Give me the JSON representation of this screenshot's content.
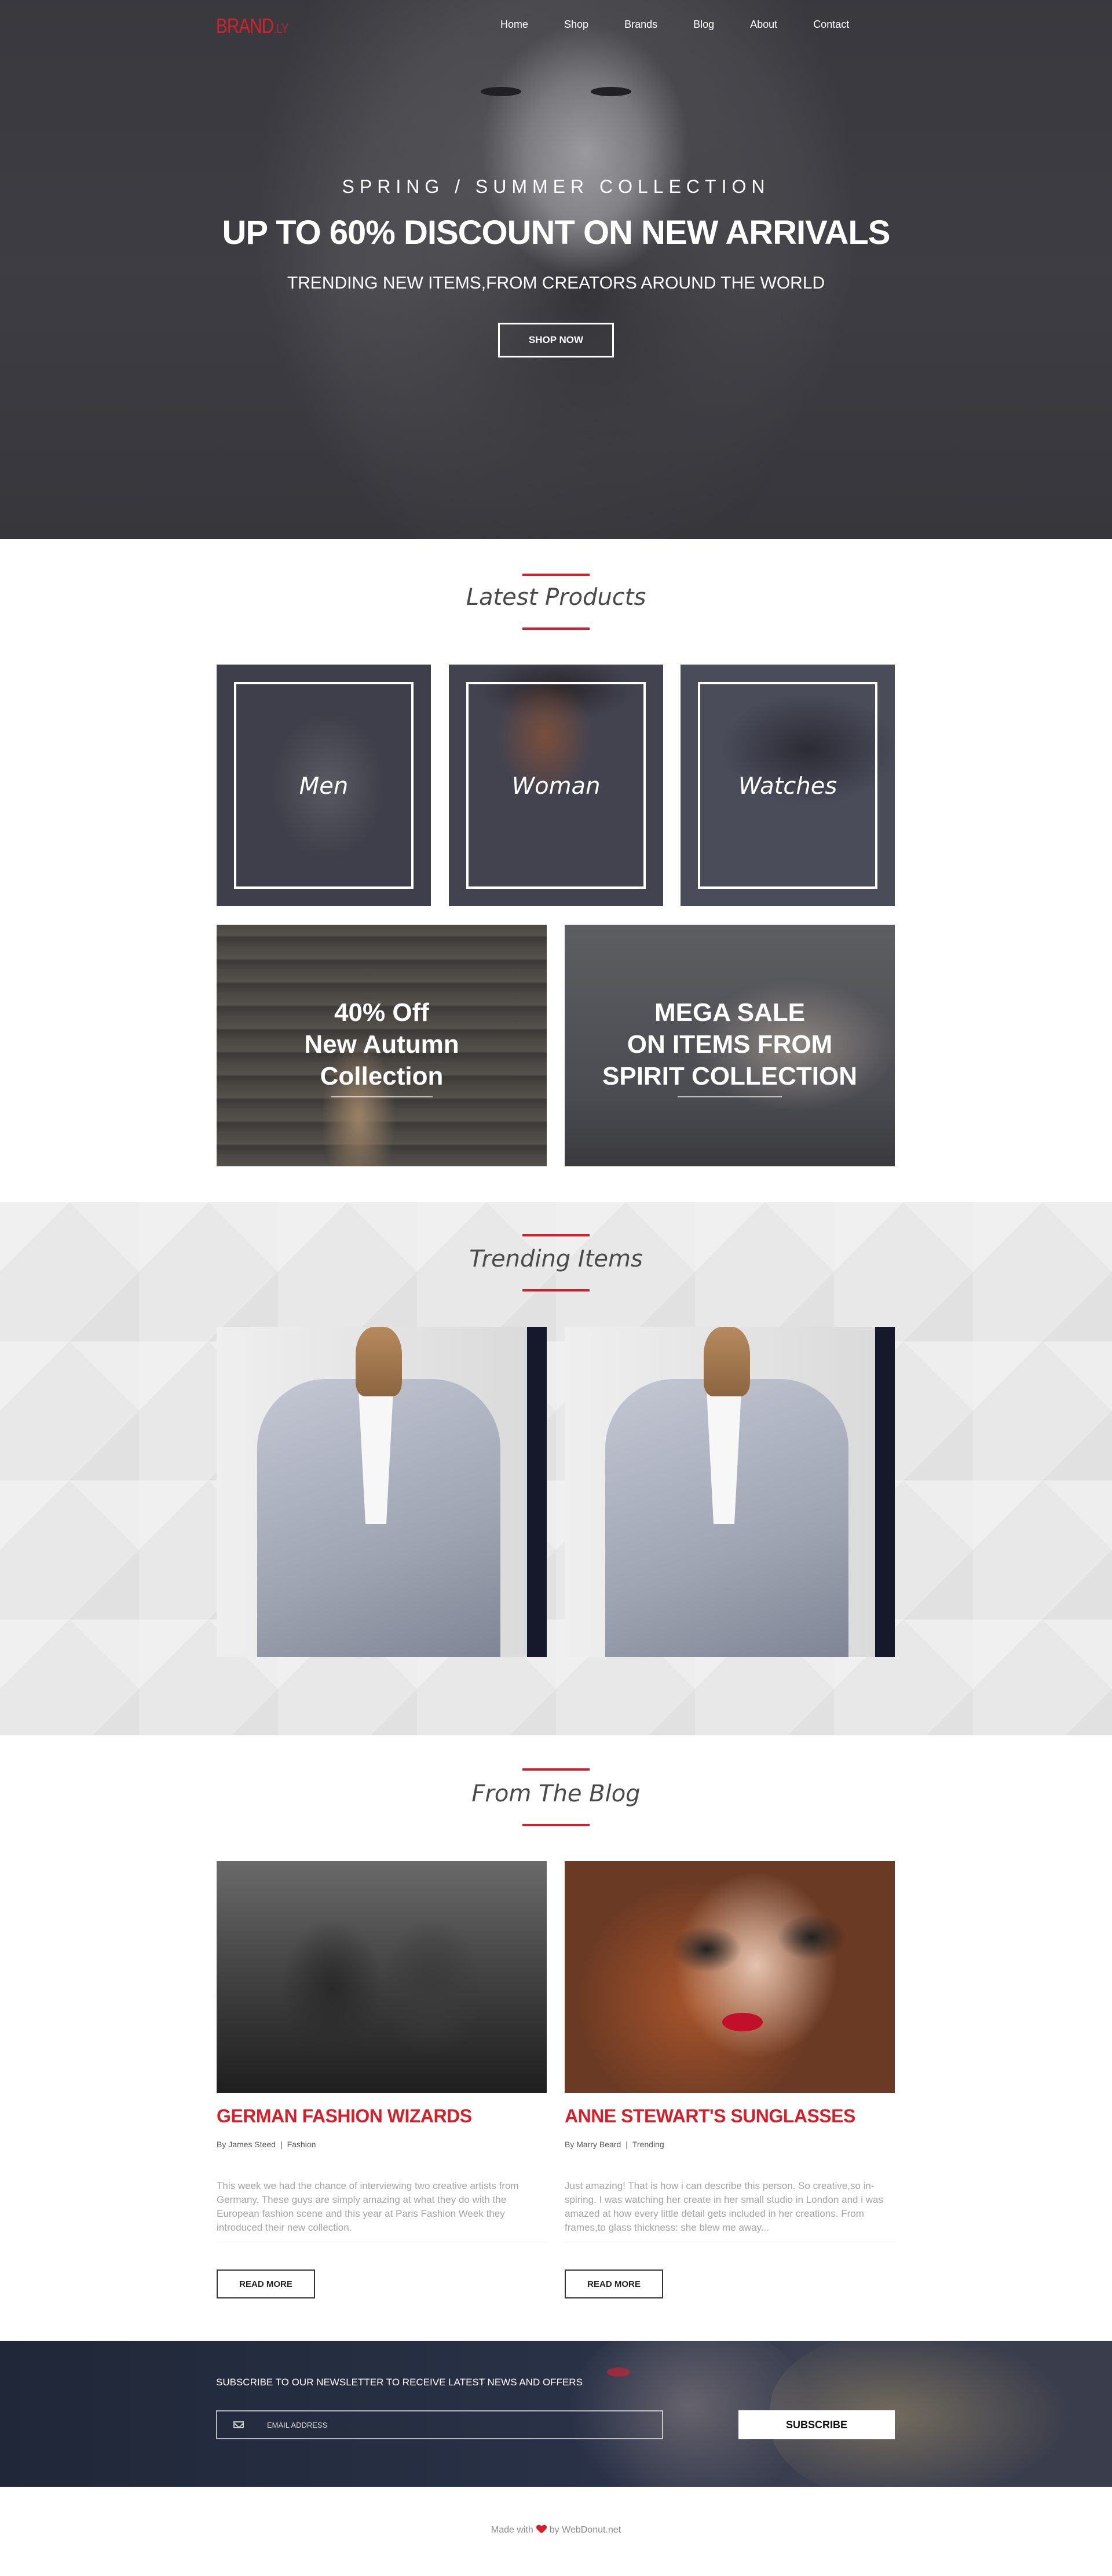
{
  "brand": {
    "name": "BRAND",
    "suffix": ".LY"
  },
  "nav": {
    "items": [
      {
        "label": "Home"
      },
      {
        "label": "Shop"
      },
      {
        "label": "Brands"
      },
      {
        "label": "Blog"
      },
      {
        "label": "About"
      },
      {
        "label": "Contact"
      }
    ]
  },
  "hero": {
    "eyebrow": "SPRING / SUMMER COLLECTION",
    "title": "UP TO 60% DISCOUNT ON NEW ARRIVALS",
    "subtitle": "TRENDING NEW ITEMS,FROM CREATORS AROUND THE WORLD",
    "button": "SHOP NOW"
  },
  "latest": {
    "title": "Latest Products",
    "categories": [
      {
        "label": "Men"
      },
      {
        "label": "Woman"
      },
      {
        "label": "Watches"
      }
    ],
    "promos": [
      {
        "lines": [
          "40% Off",
          "New Autumn",
          "Collection"
        ]
      },
      {
        "lines": [
          "MEGA SALE",
          "ON ITEMS FROM",
          "SPIRIT COLLECTION"
        ]
      }
    ]
  },
  "trending": {
    "title": "Trending Items"
  },
  "blog": {
    "title": "From The Blog",
    "posts": [
      {
        "title": "GERMAN FASHION WIZARDS",
        "author": "By James Steed",
        "category": "Fashion",
        "excerpt": "This week we had the chance of interviewing two creative artists from Germany. These guys are simply amazing at what they do with the European fashion scene and this year at Paris Fashion Week they introduced their new collection.",
        "button": "READ MORE"
      },
      {
        "title": "ANNE STEWART'S SUNGLASSES",
        "author": "By Marry Beard",
        "category": "Trending",
        "excerpt": "Just amazing! That is how i can describe this person. So creative,so in-spiring. I was watching her create in her small studio in London and i was amazed at how every little detail gets included in her creations. From frames,to glass thickness: she blew me away...",
        "button": "READ MORE"
      }
    ]
  },
  "newsletter": {
    "title": "SUBSCRIBE TO OUR NEWSLETTER TO RECEIVE LATEST NEWS AND OFFERS",
    "placeholder": "EMAIL ADDRESS",
    "button": "SUBSCRIBE"
  },
  "footer": {
    "made_with": "Made with",
    "by": "by WebDonut.net"
  },
  "colors": {
    "accent": "#d4202b"
  }
}
